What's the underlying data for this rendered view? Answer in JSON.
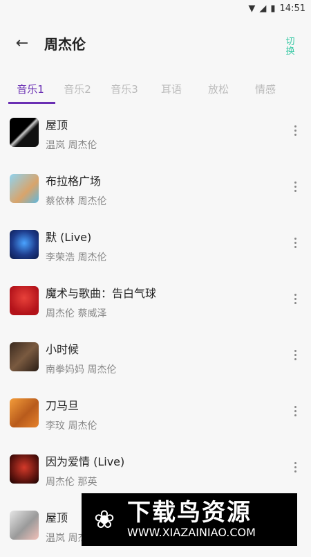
{
  "status": {
    "time": "14:51"
  },
  "header": {
    "title": "周杰伦",
    "switch_label": "切换",
    "back_icon": "arrow-left-icon"
  },
  "tabs": [
    {
      "label": "音乐1",
      "active": true
    },
    {
      "label": "音乐2"
    },
    {
      "label": "音乐3"
    },
    {
      "label": "耳语"
    },
    {
      "label": "放松"
    },
    {
      "label": "情感"
    }
  ],
  "songs": [
    {
      "title": "屋顶",
      "artist": "温岚 周杰伦"
    },
    {
      "title": "布拉格广场",
      "artist": "蔡依林 周杰伦"
    },
    {
      "title": "默 (Live)",
      "artist": "李荣浩 周杰伦"
    },
    {
      "title": "魔术与歌曲：告白气球",
      "artist": "周杰伦 蔡威泽"
    },
    {
      "title": "小时候",
      "artist": "南拳妈妈 周杰伦"
    },
    {
      "title": "刀马旦",
      "artist": "李玟 周杰伦"
    },
    {
      "title": "因为爱情 (Live)",
      "artist": "周杰伦 那英"
    },
    {
      "title": "屋顶",
      "artist": "温岚 周杰伦"
    }
  ],
  "watermark": {
    "main": "下载鸟资源",
    "url": "WWW.XIAZAINIAO.COM"
  },
  "colors": {
    "accent": "#6a2fb3",
    "switch": "#39c9a5"
  }
}
